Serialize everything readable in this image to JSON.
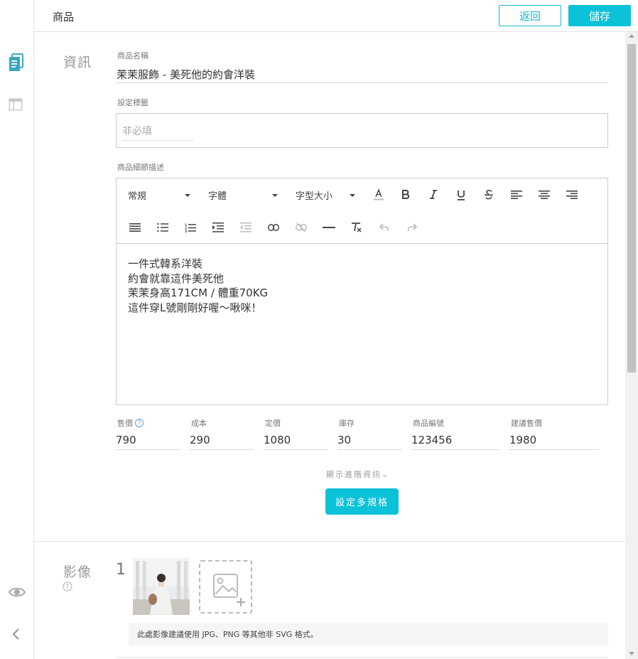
{
  "header": {
    "title": "商品",
    "back_label": "返回",
    "save_label": "儲存"
  },
  "sidebar": {
    "items": [
      {
        "icon": "document-icon",
        "active": true
      },
      {
        "icon": "layout-icon",
        "active": false
      }
    ],
    "bottom": [
      {
        "icon": "eye-icon"
      },
      {
        "icon": "chevron-left-icon"
      }
    ]
  },
  "info_section": {
    "label": "資訊",
    "product_name": {
      "label": "商品名稱",
      "value": "茉茉服飾 - 美死他的約會洋裝"
    },
    "tags": {
      "label": "設定標籤",
      "placeholder": "非必填"
    },
    "description": {
      "label": "商品細節描述",
      "toolbar": {
        "format": "常規",
        "font": "字體",
        "size": "字型大小"
      },
      "lines": [
        "一件式韓系洋裝",
        "約會就靠這件美死他",
        "茉茉身高171CM / 體重70KG",
        "這件穿L號剛剛好喔～啾咪！"
      ]
    },
    "prices": {
      "sale": {
        "label": "售價",
        "value": "790"
      },
      "cost": {
        "label": "成本",
        "value": "290"
      },
      "list": {
        "label": "定價",
        "value": "1080"
      },
      "stock": {
        "label": "庫存",
        "value": "30"
      },
      "sku": {
        "label": "商品編號",
        "value": "123456"
      },
      "suggested": {
        "label": "建議售價",
        "value": "1980"
      }
    },
    "advanced_link": "顯示進階資訊",
    "variant_button": "設定多規格"
  },
  "image_section": {
    "label": "影像",
    "index": "1",
    "notice": "此處影像建議使用 JPG、PNG 等其他非 SVG 格式。"
  },
  "colors": {
    "accent": "#0cc2d8",
    "accent_border": "#19b6cc",
    "sidebar_active": "#3aa7c0"
  }
}
